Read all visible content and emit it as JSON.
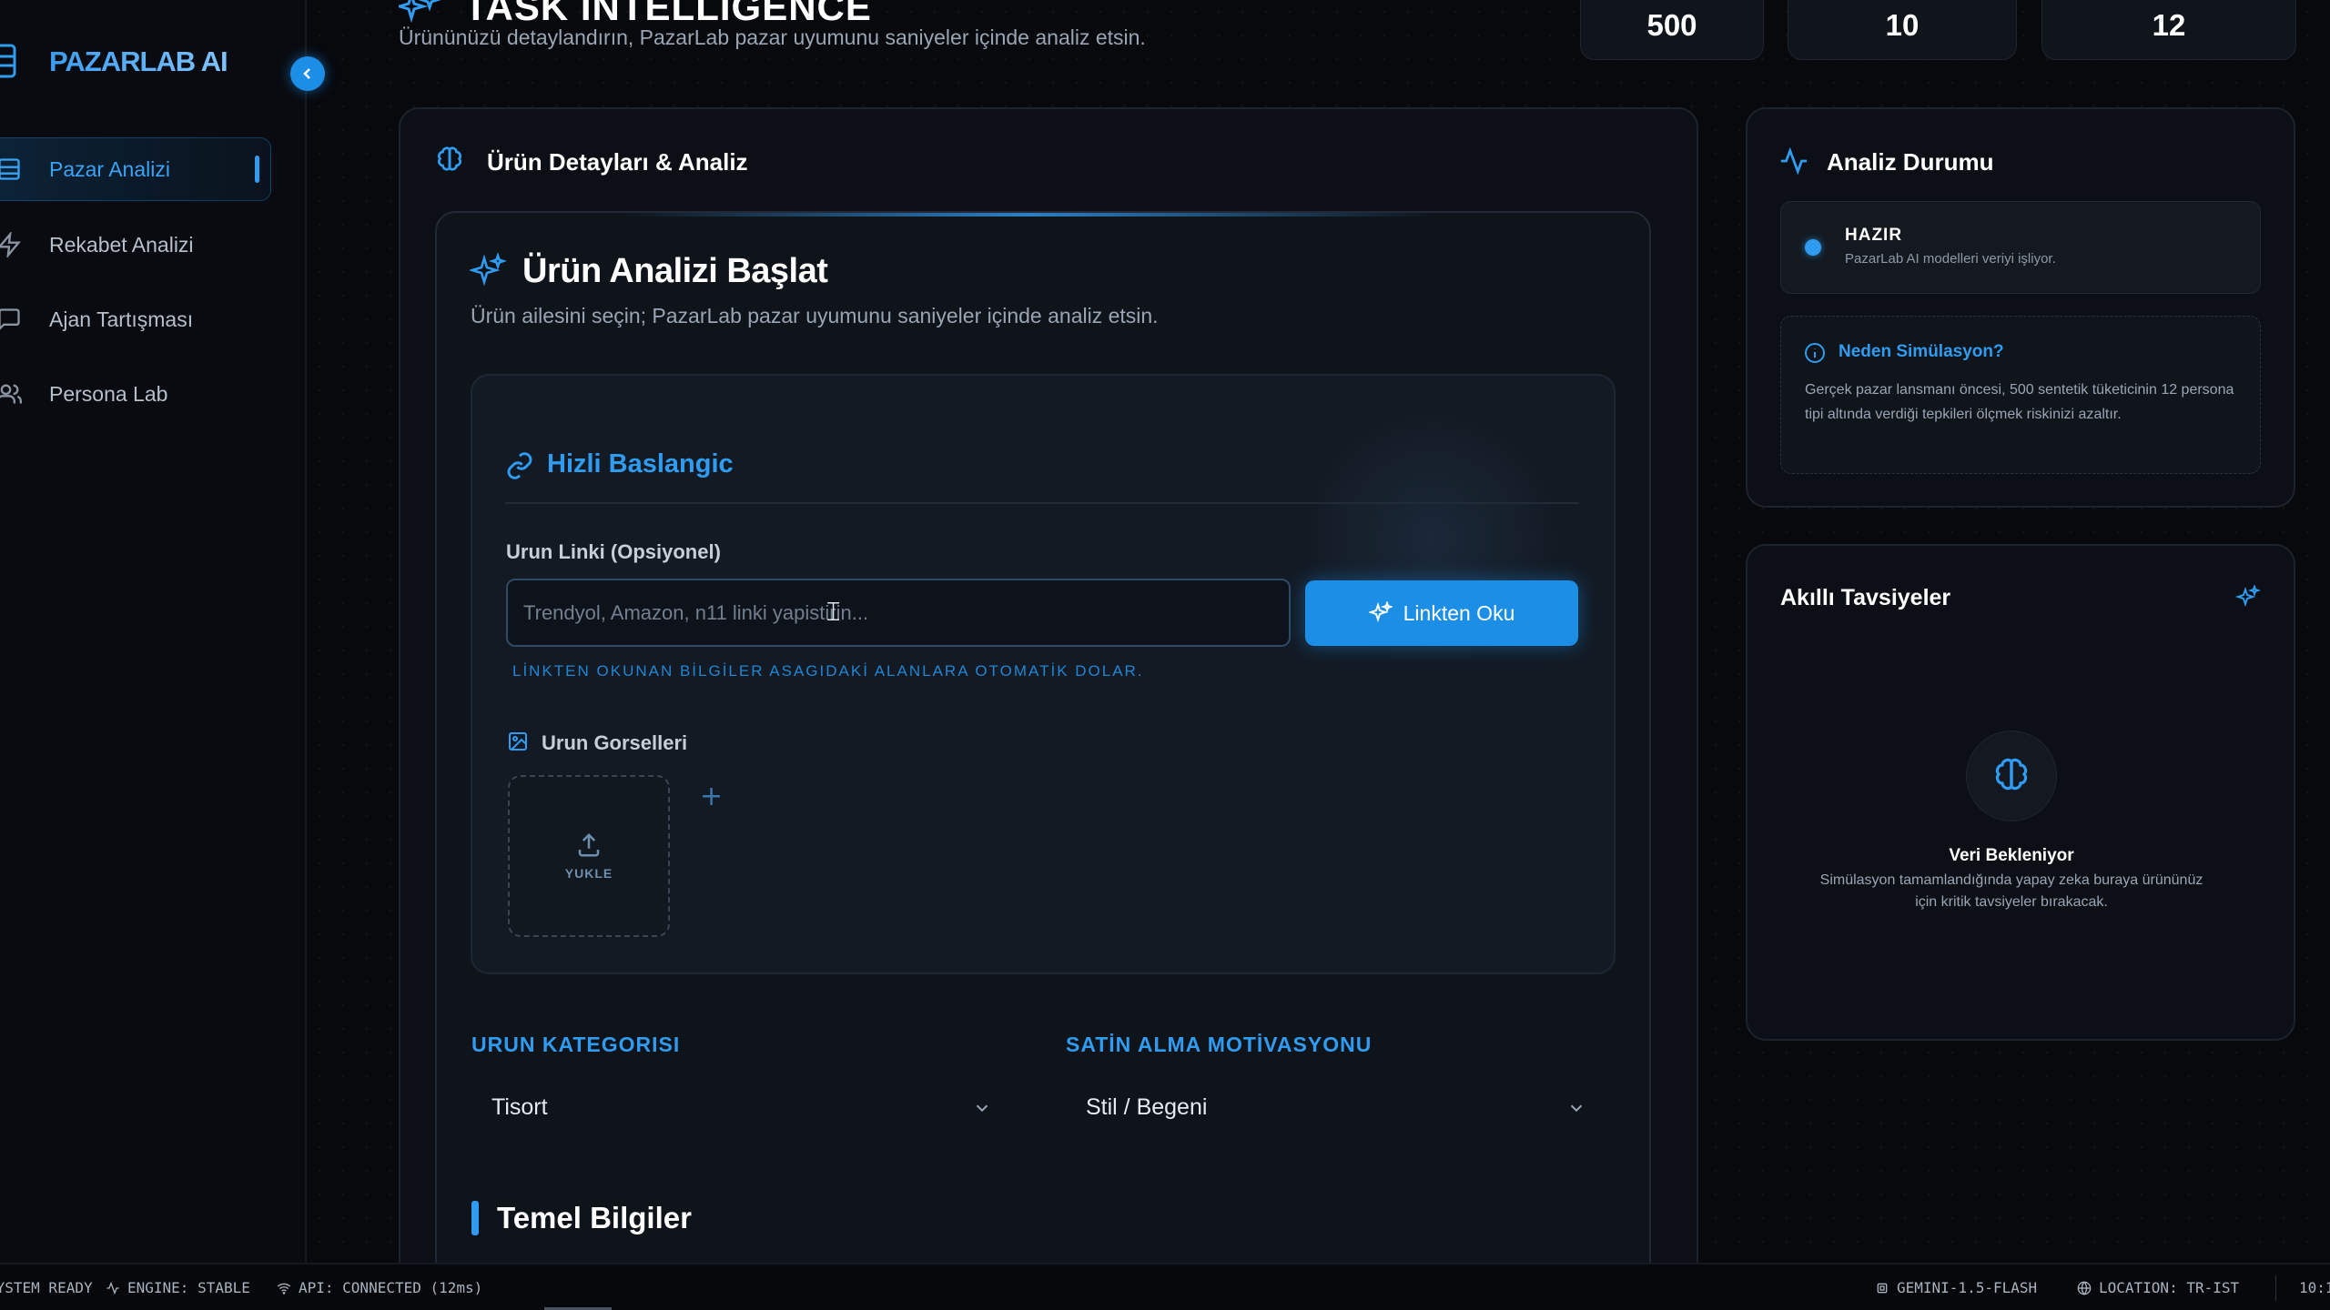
{
  "brand": {
    "name": "PAZARLAB AI"
  },
  "sidebar": {
    "items": [
      {
        "label": "Pazar Analizi",
        "icon": "layout-icon",
        "active": true
      },
      {
        "label": "Rekabet Analizi",
        "icon": "zap-icon",
        "active": false
      },
      {
        "label": "Ajan Tartışması",
        "icon": "message-square-icon",
        "active": false
      },
      {
        "label": "Persona Lab",
        "icon": "users-icon",
        "active": false
      }
    ]
  },
  "header": {
    "title": "TASK INTELLIGENCE",
    "subtitle": "Ürününüzü detaylandırın, PazarLab pazar uyumunu saniyeler içinde analiz etsin.",
    "stats": [
      "500",
      "10",
      "12"
    ]
  },
  "main": {
    "panel_title": "Ürün Detayları & Analiz",
    "start_title": "Ürün Analizi Başlat",
    "start_subtitle": "Ürün ailesini seçin; PazarLab pazar uyumunu saniyeler içinde analiz etsin.",
    "quick_start": {
      "title": "Hizli Baslangic",
      "link_label": "Urun Linki (Opsiyonel)",
      "link_placeholder": "Trendyol, Amazon, n11 linki yapistirin...",
      "link_value": "",
      "read_button": "Linkten Oku",
      "hint": "LİNKTEN OKUNAN BİLGİLER ASAGIDAKİ ALANLARA OTOMATİK DOLAR.",
      "images_label": "Urun Gorselleri",
      "upload_label": "YUKLE",
      "add_label": "+"
    },
    "category_label": "URUN KATEGORISI",
    "category_value": "Tisort",
    "motivation_label": "SATİN ALMA MOTİVASYONU",
    "motivation_value": "Stil / Begeni",
    "basic_info_title": "Temel Bilgiler"
  },
  "status_panel": {
    "title": "Analiz Durumu",
    "ready_title": "HAZIR",
    "ready_sub": "PazarLab AI modelleri veriyi işliyor.",
    "why_title": "Neden Simülasyon?",
    "why_text": "Gerçek pazar lansmanı öncesi, 500 sentetik tüketicinin 12 persona tipi altında verdiği tepkileri ölçmek riskinizi azaltır."
  },
  "recommendations": {
    "title": "Akıllı Tavsiyeler",
    "waiting_title": "Veri Bekleniyor",
    "waiting_desc": "Simülasyon tamamlandığında yapay zeka buraya ürününüz için kritik tavsiyeler bırakacak."
  },
  "statusbar": {
    "system": "SYSTEM READY",
    "engine": "ENGINE: STABLE",
    "api": "API: CONNECTED (12ms)",
    "model": "GEMINI-1.5-FLASH",
    "location": "LOCATION: TR-IST",
    "time": "10:1"
  },
  "colors": {
    "accent": "#1c8ee6",
    "accent_light": "#2f9cf2",
    "background": "#07090d",
    "panel": "#0c0f15"
  }
}
